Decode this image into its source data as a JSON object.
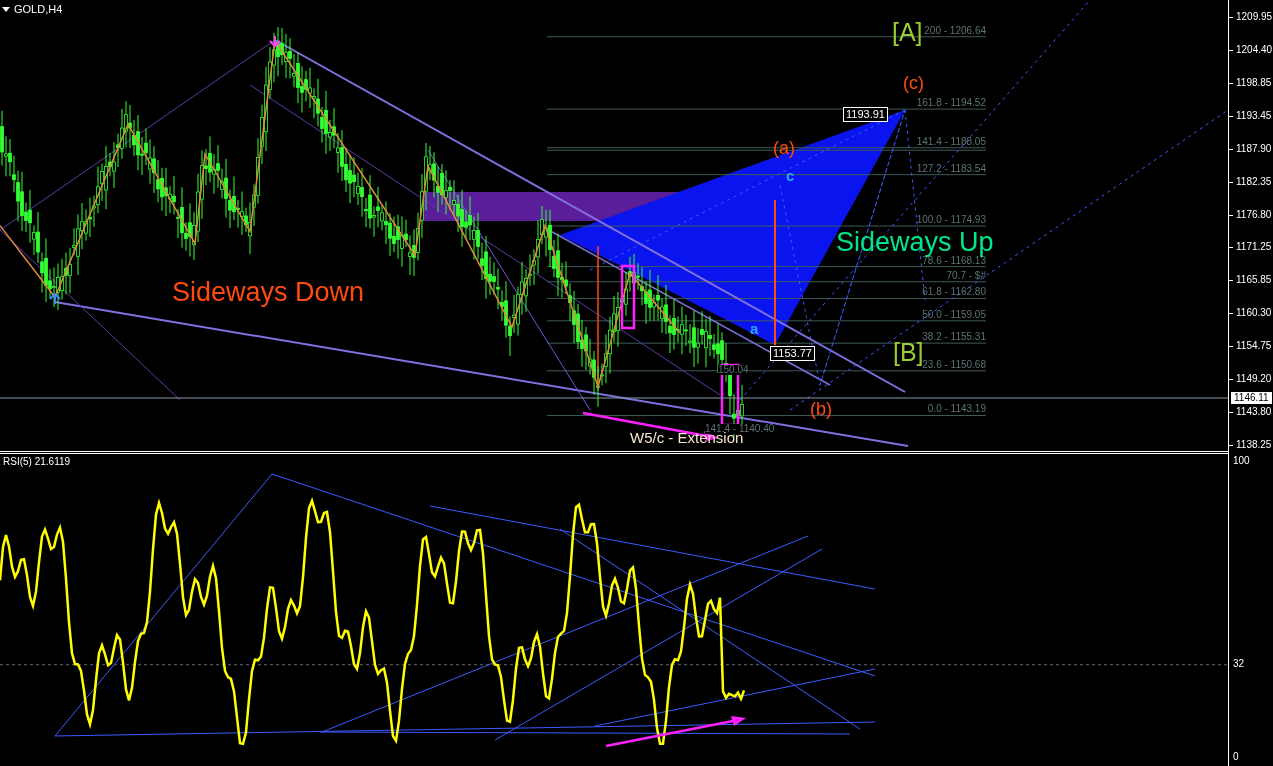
{
  "chart": {
    "symbol": "GOLD,H4",
    "price_axis": [
      "1209.95",
      "1204.40",
      "1198.85",
      "1193.45",
      "1187.90",
      "1182.35",
      "1176.80",
      "1171.25",
      "1165.85",
      "1160.30",
      "1154.75",
      "1149.20",
      "1143.80",
      "1138.25"
    ],
    "current_price": "1146.11",
    "fib_levels": [
      {
        "label": "200 - 1206.64"
      },
      {
        "label": "161.8 - 1194.52"
      },
      {
        "label": "141.4 - 1188.05"
      },
      {
        "label": "127.2 - 1183.54"
      },
      {
        "label": "100.0 - 1174.93"
      },
      {
        "label": "78.6 - 1168.13"
      },
      {
        "label": "70.7 - $#"
      },
      {
        "label": "61.8 - 1162.80"
      },
      {
        "label": "50.0 - 1159.05"
      },
      {
        "label": "38.2 - 1155.31"
      },
      {
        "label": "23.6 - 1150.68"
      },
      {
        "label": "0.0 - 1143.19"
      }
    ],
    "small_fib_labels": [
      "150.04",
      "141.4 - 1140.40"
    ],
    "annotations": [
      {
        "text": "[A]",
        "kind": "major"
      },
      {
        "text": "(c)",
        "kind": "minor"
      },
      {
        "text": "(a)",
        "kind": "minor"
      },
      {
        "text": "c",
        "kind": "sub"
      },
      {
        "text": "Sideways Up",
        "kind": "caption_up"
      },
      {
        "text": "Sideways Down",
        "kind": "caption_down"
      },
      {
        "text": "a",
        "kind": "sub"
      },
      {
        "text": "[B]",
        "kind": "major"
      },
      {
        "text": "(b)",
        "kind": "minor"
      },
      {
        "text": "W5/c - Extension",
        "kind": "note"
      }
    ],
    "price_tags": [
      "1193.91",
      "1153.77"
    ]
  },
  "indicator": {
    "title": "RSI(5) 21.6119",
    "axis": [
      "100",
      "32",
      "0"
    ]
  }
}
